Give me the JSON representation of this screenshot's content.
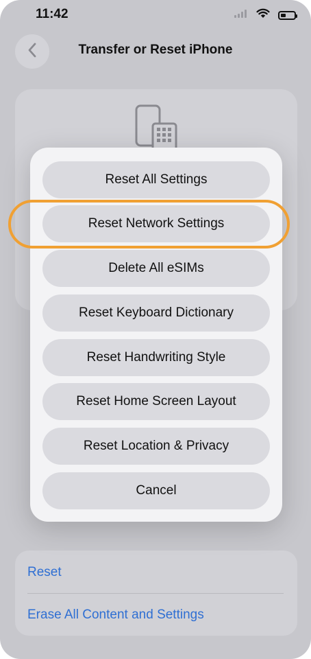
{
  "status_bar": {
    "time": "11:42",
    "icons": [
      "signal-icon",
      "wifi-icon",
      "battery-icon"
    ],
    "battery_level": 0.4
  },
  "nav": {
    "back_icon": "chevron-left-icon",
    "title": "Transfer or Reset iPhone"
  },
  "background_card": {
    "icon": "phone-transfer-icon"
  },
  "action_sheet": {
    "items": [
      {
        "label": "Reset All Settings"
      },
      {
        "label": "Reset Network Settings"
      },
      {
        "label": "Delete All eSIMs"
      },
      {
        "label": "Reset Keyboard Dictionary"
      },
      {
        "label": "Reset Handwriting Style"
      },
      {
        "label": "Reset Home Screen Layout"
      },
      {
        "label": "Reset Location & Privacy"
      },
      {
        "label": "Cancel"
      }
    ],
    "highlighted_item": "Reset Network Settings"
  },
  "bottom_list": {
    "reset_label": "Reset",
    "erase_label": "Erase All Content and Settings"
  },
  "colors": {
    "link_blue": "#2f6fd3",
    "highlight_orange": "#f0a033",
    "sheet_background": "#f3f3f5",
    "button_background": "#dadadf"
  }
}
